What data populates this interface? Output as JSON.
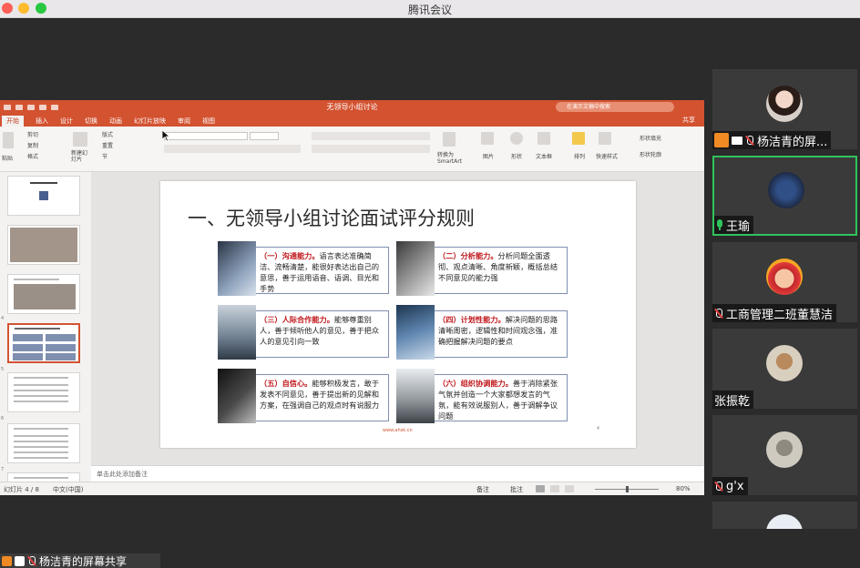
{
  "window": {
    "title": "腾讯会议"
  },
  "share": {
    "label": "杨洁青的屏幕共享"
  },
  "ppt": {
    "doc_title": "无领导小组讨论",
    "search_placeholder": "在演示文稿中搜索",
    "share_button": "共享",
    "tabs": [
      "开始",
      "插入",
      "设计",
      "切换",
      "动画",
      "幻灯片放映",
      "审阅",
      "视图"
    ],
    "ribbon": {
      "paste": "粘贴",
      "cut": "剪切",
      "copy": "复制",
      "format": "格式",
      "new_slide": "新建幻灯片",
      "layout": "版式",
      "reset": "重置",
      "section": "节",
      "convert_smartart": "转换为SmartArt",
      "picture": "图片",
      "shapes": "形状",
      "textbox": "文本框",
      "arrange": "排列",
      "quick_styles": "快速样式",
      "shape_fill": "形状填充",
      "shape_outline": "形状轮廓"
    },
    "slide": {
      "title": "一、无领导小组讨论面试评分规则",
      "cards": [
        {
          "heading": "（一）沟通能力。",
          "body": "语言表达准确简洁、流畅清楚，能很好表达出自己的意思，善于运用语音、语调、目光和手势"
        },
        {
          "heading": "（二）分析能力。",
          "body": "分析问题全面透彻、观点清晰、角度新颖，概括总结不同意见的能力强"
        },
        {
          "heading": "（三）人际合作能力。",
          "body": "能够尊重别人，善于倾听他人的意见，善于把众人的意见引向一致"
        },
        {
          "heading": "（四）计划性能力。",
          "body": "解决问题的思路清晰周密，逻辑性和时间观念强，准确把握解决问题的要点"
        },
        {
          "heading": "（五）自信心。",
          "body": "能够积极发言，敢于发表不同意见，善于提出新的见解和方案，在强调自己的观点时有说服力"
        },
        {
          "heading": "（六）组织协调能力。",
          "body": "善于消除紧张气氛并创造一个大家都想发言的气氛，能有效说服别人，善于调解争议问题"
        }
      ],
      "footer": "www.ahsk.cn",
      "number": "4"
    },
    "notes_placeholder": "单击此处添加备注",
    "status": {
      "slide_counter": "幻灯片 4 / 8",
      "language": "中文(中国)",
      "notes": "备注",
      "comments": "批注",
      "zoom": "80%"
    }
  },
  "participants": [
    {
      "name": "杨洁青的屏...",
      "speaking": false
    },
    {
      "name": "王瑜",
      "speaking": true
    },
    {
      "name": "工商管理二班董慧洁",
      "speaking": false
    },
    {
      "name": "张振乾",
      "speaking": false
    },
    {
      "name": "g'x",
      "speaking": false
    }
  ],
  "colors": {
    "ppt_accent": "#d35230",
    "speaking_border": "#2fc35c",
    "heading_red": "#c0171c"
  }
}
